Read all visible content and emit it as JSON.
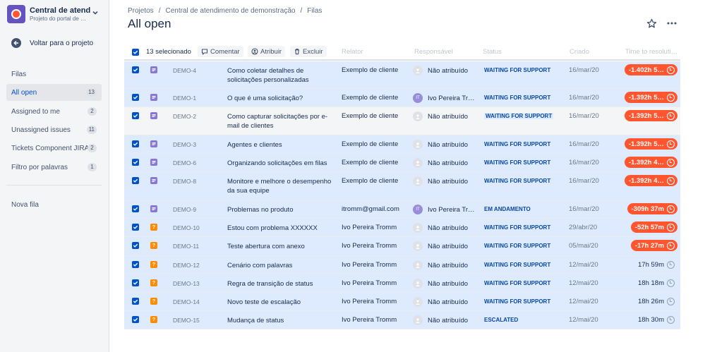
{
  "project": {
    "name": "Central de atendim…",
    "subtitle": "Projeto do portal de …",
    "back_label": "Voltar para o projeto"
  },
  "sidebar": {
    "section_title": "Filas",
    "queues": [
      {
        "label": "All open",
        "count": "13",
        "active": true
      },
      {
        "label": "Assigned to me",
        "count": "2"
      },
      {
        "label": "Unassigned issues",
        "count": "11"
      },
      {
        "label": "Tickets Component JIRA",
        "count": "2"
      },
      {
        "label": "Filtro por palavras",
        "count": "1"
      }
    ],
    "new_queue": "Nova fila"
  },
  "breadcrumb": [
    "Projetos",
    "Central de atendimento de demonstração",
    "Filas"
  ],
  "page_title": "All open",
  "toolbar": {
    "selected": "13 selecionado",
    "comment": "Comentar",
    "assign": "Atribuir",
    "delete": "Excluir"
  },
  "columns": {
    "reporter": "Relator",
    "assignee": "Responsável",
    "status": "Status",
    "created": "Criado",
    "sla": "Time to resoluti…"
  },
  "rows": [
    {
      "type": "task",
      "key": "DEMO-4",
      "summary": "Como coletar detalhes de solicitações personalizadas",
      "reporter": "Exemplo de cliente",
      "assignee": "Não atribuído",
      "status": "WAITING FOR SUPPORT",
      "created": "16/mar/20",
      "sla": "-1.402h 5…",
      "breached": true
    },
    {
      "type": "task",
      "key": "DEMO-1",
      "summary": "O que é uma solicitação?",
      "reporter": "Exemplo de cliente",
      "assignee": "Ivo Pereira Tr…",
      "assignee_initials": "IT",
      "status": "WAITING FOR SUPPORT",
      "created": "16/mar/20",
      "sla": "-1.392h 5…",
      "breached": true
    },
    {
      "type": "task",
      "key": "DEMO-2",
      "summary": "Como capturar solicitações por e-mail de clientes",
      "reporter": "Exemplo de cliente",
      "assignee": "Não atribuído",
      "status": "WAITING FOR SUPPORT",
      "created": "16/mar/20",
      "sla": "-1.392h 5…",
      "breached": true
    },
    {
      "type": "task",
      "key": "DEMO-3",
      "summary": "Agentes e clientes",
      "reporter": "Exemplo de cliente",
      "assignee": "Não atribuído",
      "status": "WAITING FOR SUPPORT",
      "created": "16/mar/20",
      "sla": "-1.392h 5…",
      "breached": true
    },
    {
      "type": "task",
      "key": "DEMO-6",
      "summary": "Organizando solicitações em filas",
      "reporter": "Exemplo de cliente",
      "assignee": "Não atribuído",
      "status": "WAITING FOR SUPPORT",
      "created": "16/mar/20",
      "sla": "-1.392h 4…",
      "breached": true
    },
    {
      "type": "task",
      "key": "DEMO-8",
      "summary": "Monitore e melhore o desempenho da sua equipe",
      "reporter": "Exemplo de cliente",
      "assignee": "Não atribuído",
      "status": "WAITING FOR SUPPORT",
      "created": "16/mar/20",
      "sla": "-1.392h 4…",
      "breached": true
    },
    {
      "type": "task",
      "key": "DEMO-9",
      "summary": "Problemas no produto",
      "reporter": "itromm@gmail.com",
      "assignee": "Ivo Pereira Tr…",
      "assignee_initials": "IT",
      "status": "EM ANDAMENTO",
      "created": "16/mar/20",
      "sla": "-309h 37m",
      "breached": true
    },
    {
      "type": "q",
      "key": "DEMO-10",
      "summary": "Estou com problema XXXXXX",
      "reporter": "Ivo Pereira Tromm",
      "assignee": "Não atribuído",
      "status": "WAITING FOR SUPPORT",
      "created": "29/abr/20",
      "sla": "-52h 57m",
      "breached": true
    },
    {
      "type": "q",
      "key": "DEMO-11",
      "summary": "Teste abertura com anexo",
      "reporter": "Ivo Pereira Tromm",
      "assignee": "Não atribuído",
      "status": "WAITING FOR SUPPORT",
      "created": "05/mai/20",
      "sla": "-17h 27m",
      "breached": true
    },
    {
      "type": "q",
      "key": "DEMO-12",
      "summary": "Cenário com palavras",
      "reporter": "Ivo Pereira Tromm",
      "assignee": "Não atribuído",
      "status": "WAITING FOR SUPPORT",
      "created": "12/mai/20",
      "sla": "17h 59m",
      "breached": false
    },
    {
      "type": "q",
      "key": "DEMO-13",
      "summary": "Regra de transição de status",
      "reporter": "Ivo Pereira Tromm",
      "assignee": "Não atribuído",
      "status": "WAITING FOR SUPPORT",
      "created": "12/mai/20",
      "sla": "18h 18m",
      "breached": false
    },
    {
      "type": "q",
      "key": "DEMO-14",
      "summary": "Novo teste de escalação",
      "reporter": "Ivo Pereira Tromm",
      "assignee": "Não atribuído",
      "status": "WAITING FOR SUPPORT",
      "created": "12/mai/20",
      "sla": "18h 26m",
      "breached": false
    },
    {
      "type": "q",
      "key": "DEMO-15",
      "summary": "Mudança de status",
      "reporter": "Ivo Pereira Tromm",
      "assignee": "Não atribuído",
      "status": "ESCALATED",
      "created": "12/mai/20",
      "sla": "18h 30m",
      "breached": false
    }
  ]
}
